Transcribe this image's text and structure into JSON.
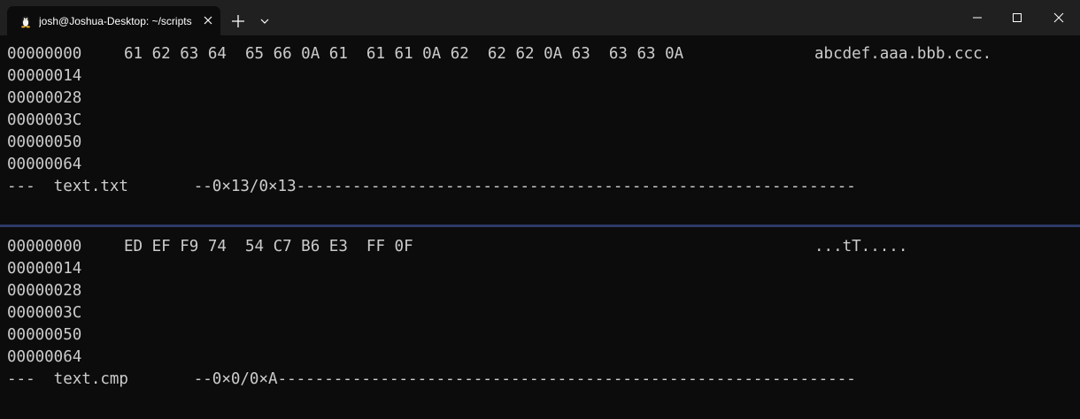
{
  "tab": {
    "title": "josh@Joshua-Desktop: ~/scripts"
  },
  "top_pane": {
    "rows": [
      {
        "address": "00000000",
        "hex": "61 62 63 64  65 66 0A 61  61 61 0A 62  62 62 0A 63  63 63 0A",
        "ascii": "abcdef.aaa.bbb.ccc."
      },
      {
        "address": "00000014",
        "hex": "",
        "ascii": ""
      },
      {
        "address": "00000028",
        "hex": "",
        "ascii": ""
      },
      {
        "address": "0000003C",
        "hex": "",
        "ascii": ""
      },
      {
        "address": "00000050",
        "hex": "",
        "ascii": ""
      },
      {
        "address": "00000064",
        "hex": "",
        "ascii": ""
      }
    ],
    "status_line": "---  text.txt       --0×13/0×13------------------------------------------------------------"
  },
  "bottom_pane": {
    "rows": [
      {
        "address": "00000000",
        "hex": "ED EF F9 74  54 C7 B6 E3  FF 0F",
        "ascii": "...tT....."
      },
      {
        "address": "00000014",
        "hex": "",
        "ascii": ""
      },
      {
        "address": "00000028",
        "hex": "",
        "ascii": ""
      },
      {
        "address": "0000003C",
        "hex": "",
        "ascii": ""
      },
      {
        "address": "00000050",
        "hex": "",
        "ascii": ""
      },
      {
        "address": "00000064",
        "hex": "",
        "ascii": ""
      }
    ],
    "status_line": "---  text.cmp       --0×0/0×A--------------------------------------------------------------"
  },
  "icons": {
    "tab_icon": "linux-penguin-icon",
    "tab_close": "close-icon",
    "new_tab": "plus-icon",
    "dropdown": "chevron-down-icon",
    "minimize": "minimize-icon",
    "maximize": "maximize-icon",
    "close": "close-icon"
  },
  "colors": {
    "terminal_background": "#0c0c0c",
    "terminal_foreground": "#cccccc",
    "titlebar_background": "#202020",
    "pane_separator": "#2c3a66"
  }
}
